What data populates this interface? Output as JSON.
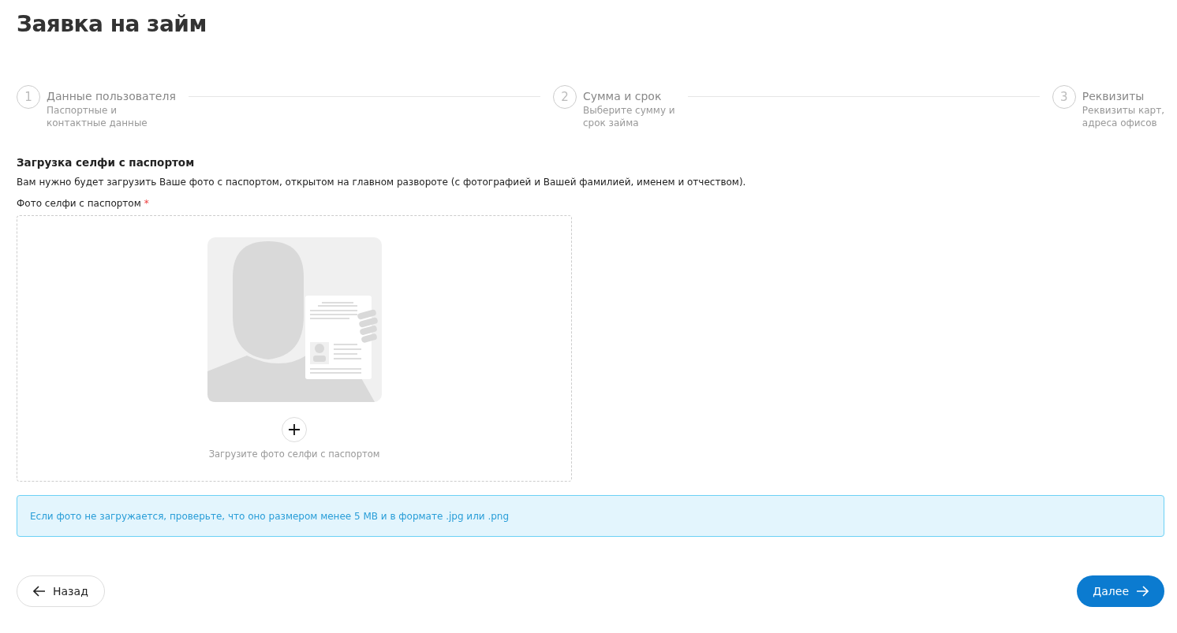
{
  "page_title": "Заявка на займ",
  "steps": [
    {
      "number": "1",
      "title": "Данные пользователя",
      "subtitle": [
        "Паспортные и",
        "контактные данные"
      ]
    },
    {
      "number": "2",
      "title": "Сумма и срок",
      "subtitle": [
        "Выберите сумму и",
        "срок займа"
      ]
    },
    {
      "number": "3",
      "title": "Реквизиты",
      "subtitle": [
        "Реквизиты карт,",
        "адреса офисов"
      ]
    }
  ],
  "section": {
    "heading": "Загрузка селфи с паспортом",
    "description": "Вам нужно будет загрузить Ваше фото с паспортом, открытом на главном развороте (с фотографией и Вашей фамилией, именем и отчеством).",
    "field_label": "Фото селфи с паспортом",
    "required_mark": "*",
    "upload_hint": "Загрузите фото селфи с паспортом"
  },
  "info": "Если фото не загружается, проверьте, что оно размером менее 5 MB и в формате .jpg или .png",
  "buttons": {
    "back": "Назад",
    "next": "Далее"
  }
}
